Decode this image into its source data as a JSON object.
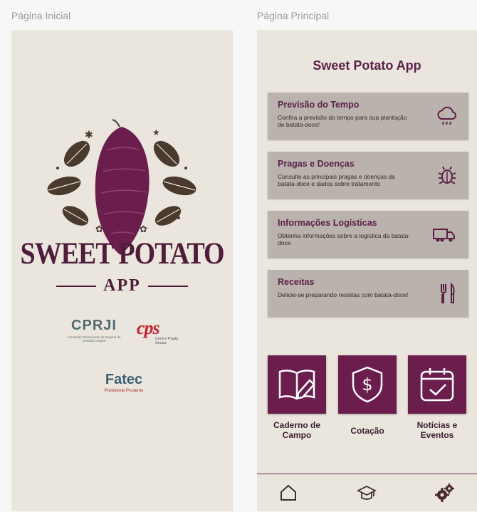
{
  "screens": {
    "left_label": "Página Inicial",
    "right_label": "Página Principal"
  },
  "splash": {
    "brand_title": "SWEET POTATO",
    "brand_sub": "APP",
    "partners": {
      "cprji_name": "CPRJI",
      "cprji_caption": "Comissão Permanente de Regime de Jornada Integral",
      "cps_name": "cps",
      "cps_caption": "Centro Paula Souza",
      "fatec_name": "Fatec",
      "fatec_caption": "Presidente Prudente"
    }
  },
  "main": {
    "title": "Sweet Potato App",
    "cards": [
      {
        "title": "Previsão do Tempo",
        "desc": "Confira a previsão do tempo para sua plantação de batata-doce!",
        "icon": "cloud-rain-icon"
      },
      {
        "title": "Pragas e Doenças",
        "desc": "Consulte as principais pragas e doenças da batata-doce e dados sobre tratamento",
        "icon": "bug-icon"
      },
      {
        "title": "Informações Logísticas",
        "desc": "Obtenha informações sobre a logística da batata-doce",
        "icon": "truck-icon"
      },
      {
        "title": "Receitas",
        "desc": "Delicie-se preparando receitas com batata-doce!",
        "icon": "fork-knife-icon"
      }
    ],
    "tiles": [
      {
        "label": "Caderno de Campo",
        "icon": "notebook-pencil-icon"
      },
      {
        "label": "Cotação",
        "icon": "shield-dollar-icon"
      },
      {
        "label": "Notícias e Eventos",
        "icon": "calendar-check-icon"
      }
    ],
    "nav": [
      "home-icon",
      "graduation-cap-icon",
      "gears-icon"
    ]
  },
  "colors": {
    "accent": "#6b1e4e",
    "card_bg": "#bab3ad",
    "screen_bg": "#ebe6dd"
  }
}
